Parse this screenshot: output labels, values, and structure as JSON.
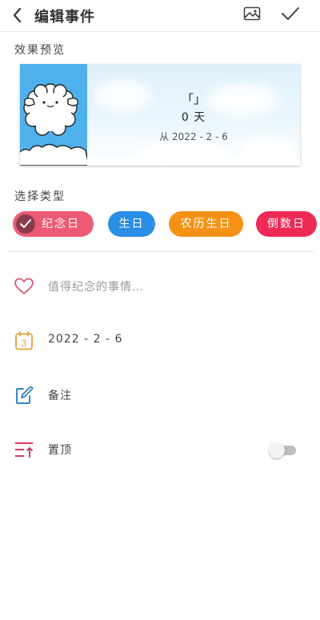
{
  "header": {
    "title": "编辑事件",
    "back_icon": "chevron-left-icon",
    "image_icon": "image-icon",
    "confirm_icon": "check-icon"
  },
  "preview": {
    "label": "效果预览",
    "name": "「」",
    "days": "0 天",
    "from": "从 2022 - 2 - 6"
  },
  "types": {
    "label": "选择类型",
    "items": [
      {
        "label": "纪念日",
        "color": "#ec5b73",
        "selected": true
      },
      {
        "label": "生日",
        "color": "#2b8ee6",
        "selected": false
      },
      {
        "label": "农历生日",
        "color": "#f59215",
        "selected": false
      },
      {
        "label": "倒数日",
        "color": "#ef2a55",
        "selected": false
      }
    ]
  },
  "form": {
    "name_placeholder": "值得纪念的事情…",
    "date": "2022 - 2 - 6",
    "calendar_day": "3",
    "note_label": "备注",
    "pin_label": "置顶",
    "pin_on": false
  },
  "colors": {
    "heart": "#d45b74",
    "calendar": "#e8a13a",
    "note": "#2f86c4",
    "pin": "#d83a5b"
  }
}
